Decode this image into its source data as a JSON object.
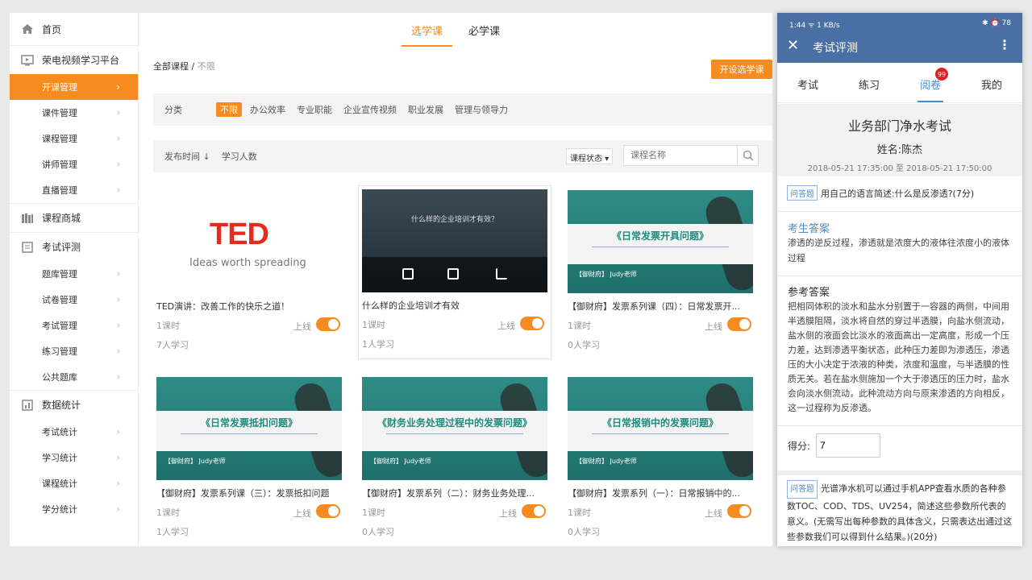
{
  "sidebar": {
    "home": "首页",
    "platform": "荣电视频学习平台",
    "platform_items": [
      "开课管理",
      "课件管理",
      "课程管理",
      "讲师管理",
      "直播管理"
    ],
    "mall": "课程商城",
    "exam": "考试评测",
    "exam_items": [
      "题库管理",
      "试卷管理",
      "考试管理",
      "练习管理",
      "公共题库"
    ],
    "stats": "数据统计",
    "stats_items": [
      "考试统计",
      "学习统计",
      "课程统计",
      "学分统计"
    ]
  },
  "main": {
    "tabs": [
      "选学课",
      "必学课"
    ],
    "breadcrumb_all": "全部课程",
    "breadcrumb_sep": "/",
    "breadcrumb_cur": "不限",
    "open_button": "开设选学课",
    "filter_label": "分类",
    "filters": [
      "不限",
      "办公效率",
      "专业职能",
      "企业宣传视频",
      "职业发展",
      "管理与领导力"
    ],
    "sort_publish": "发布时间 ↓",
    "sort_learners": "学习人数",
    "status_select": "课程状态 ▾",
    "search_placeholder": "课程名称",
    "courses": [
      {
        "title": "TED演讲：改善工作的快乐之道！",
        "hours": "1课时",
        "learners": "7人学习",
        "status": "上线",
        "thumb": "TED",
        "tagline": "Ideas worth spreading"
      },
      {
        "title": "什么样的企业培训才有效",
        "hours": "1课时",
        "learners": "1人学习",
        "status": "上线",
        "thumb": "什么样的企业培训才有效？"
      },
      {
        "title": "【御财府】发票系列课（四）：日常发票开...",
        "hours": "1课时",
        "learners": "0人学习",
        "status": "上线",
        "thumb": "《日常发票开具问题》",
        "author": "【御财府】 Judy老师"
      },
      {
        "title": "【御财府】发票系列课（三）：发票抵扣问题",
        "hours": "1课时",
        "learners": "1人学习",
        "status": "上线",
        "thumb": "《日常发票抵扣问题》",
        "author": "【御财府】 Judy老师"
      },
      {
        "title": "【御财府】发票系列（二）：财务业务处理...",
        "hours": "1课时",
        "learners": "0人学习",
        "status": "上线",
        "thumb": "《财务业务处理过程中的发票问题》",
        "author": "【御财府】 Judy老师"
      },
      {
        "title": "【御财府】发票系列（一）：日常报销中的...",
        "hours": "1课时",
        "learners": "0人学习",
        "status": "上线",
        "thumb": "《日常报销中的发票问题》",
        "author": "【御财府】 Judy老师"
      }
    ]
  },
  "phone": {
    "status_left": "1:44 ᯤ 1 KB/s",
    "status_right": "✱ ⏰ 78",
    "title": "考试评测",
    "tabs": [
      "考试",
      "练习",
      "阅卷",
      "我的"
    ],
    "badge": "99",
    "exam_name": "业务部门净水考试",
    "examinee": "姓名:陈杰",
    "time_range": "2018-05-21 17:35:00 至 2018-05-21 17:50:00",
    "q1_tag": "问答题",
    "q1_text": "用自己的语言简述:什么是反渗透?(7分)",
    "answer_heading": "考生答案",
    "answer_text": "渗透的逆反过程，渗透就是浓度大的液体往浓度小的液体过程",
    "ref_heading": "参考答案",
    "ref_text": "把相同体积的淡水和盐水分别置于一容器的两侧，中间用半透膜阻隔，淡水将自然的穿过半透膜，向盐水侧流动，盐水侧的液面会比淡水的液面高出一定高度，形成一个压力差，达到渗透平衡状态，此种压力差即为渗透压，渗透压的大小决定于浓液的种类，浓度和温度，与半透膜的性质无关。若在盐水侧施加一个大于渗透压的压力时，盐水会向淡水侧流动，此种流动方向与原来渗透的方向相反，这一过程称为反渗透。",
    "score_label": "得分:",
    "score_value": "7",
    "q2_tag": "问答题",
    "q2_text": "光谱净水机可以通过手机APP查看水质的各种参数TOC、COD、TDS、UV254，简述这些参数所代表的意义。(无需写出每种参数的具体含义，只需表达出通过这些参数我们可以得到什么结果。)(20分)"
  },
  "colors": {
    "accent": "#f68b1f",
    "phone_header": "#4a6fa5",
    "phone_accent": "#4a8ec9"
  }
}
